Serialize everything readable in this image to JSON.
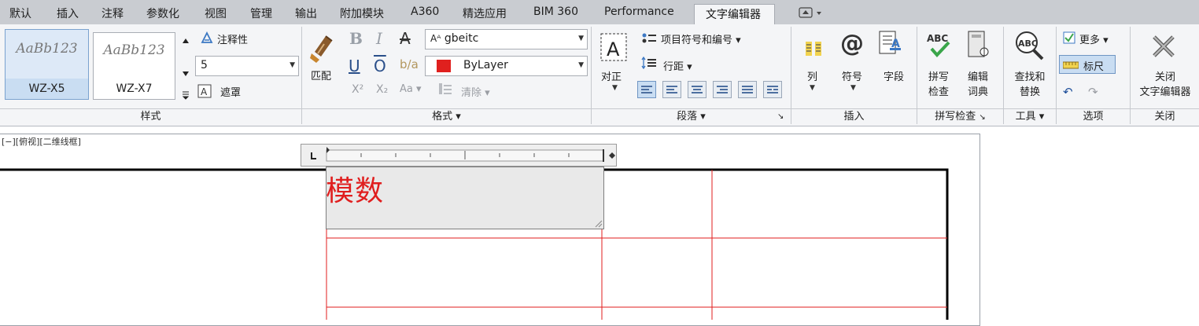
{
  "tabs": [
    "默认",
    "插入",
    "注释",
    "参数化",
    "视图",
    "管理",
    "输出",
    "附加模块",
    "A360",
    "精选应用",
    "BIM 360",
    "Performance",
    "文字编辑器"
  ],
  "active_tab": "文字编辑器",
  "panels": {
    "style": {
      "title": "样式",
      "items": [
        {
          "preview": "AaBb123",
          "name": "WZ-X5",
          "selected": true
        },
        {
          "preview": "AaBb123",
          "name": "WZ-X7",
          "selected": false
        }
      ],
      "annotative_label": "注释性",
      "height_value": "5",
      "mask_label": "遮罩"
    },
    "format": {
      "title": "格式",
      "match_label": "匹配",
      "font_value": "gbeitc",
      "color_value": "ByLayer",
      "color_swatch": "#e0201e",
      "aa_label": "Aa",
      "clear_label": "清除"
    },
    "paragraph": {
      "title": "段落",
      "justify_label": "对正",
      "bullets_label": "项目符号和编号",
      "spacing_label": "行距"
    },
    "insert": {
      "title": "插入",
      "columns_label": "列",
      "symbol_label": "符号",
      "field_label": "字段"
    },
    "spell": {
      "title": "拼写检查",
      "spellcheck_line1": "拼写",
      "spellcheck_line2": "检查",
      "dict_line1": "编辑",
      "dict_line2": "词典"
    },
    "tools": {
      "title": "工具",
      "find_line1": "查找和",
      "find_line2": "替换"
    },
    "options": {
      "title": "选项",
      "more_label": "更多",
      "ruler_label": "标尺"
    },
    "close": {
      "title": "关闭",
      "close_line1": "关闭",
      "close_line2": "文字编辑器"
    }
  },
  "viewport_label": "[−][俯视][二维线框]",
  "editor_text": "模数",
  "colors": {
    "accent": "#3c78c3",
    "drawing_red": "#e01e1e"
  }
}
